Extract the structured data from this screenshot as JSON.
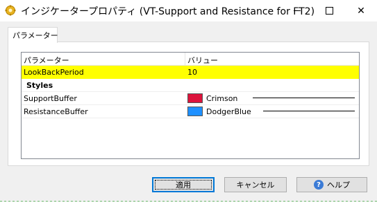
{
  "window": {
    "title": "インジケータープロパティ (VT-Support and Resistance for FT2)",
    "icon": "gear-icon",
    "close_glyph": "✕"
  },
  "tabs": [
    {
      "label": "パラメーター",
      "selected": true
    }
  ],
  "grid": {
    "headers": [
      "パラメーター",
      "バリュー"
    ],
    "rows": [
      {
        "name": "LookBackPeriod",
        "value": "10",
        "highlighted": true
      },
      {
        "category": "Styles"
      },
      {
        "name": "SupportBuffer",
        "color_name": "Crimson",
        "color": "#dc143c",
        "line_style": "solid"
      },
      {
        "name": "ResistanceBuffer",
        "color_name": "DodgerBlue",
        "color": "#1e90ff",
        "line_style": "solid"
      }
    ],
    "highlight_color": "#ffff00"
  },
  "buttons": {
    "apply": "適用",
    "cancel": "キャンセル",
    "help": "ヘルプ",
    "help_icon": "help-icon",
    "help_glyph": "?"
  }
}
